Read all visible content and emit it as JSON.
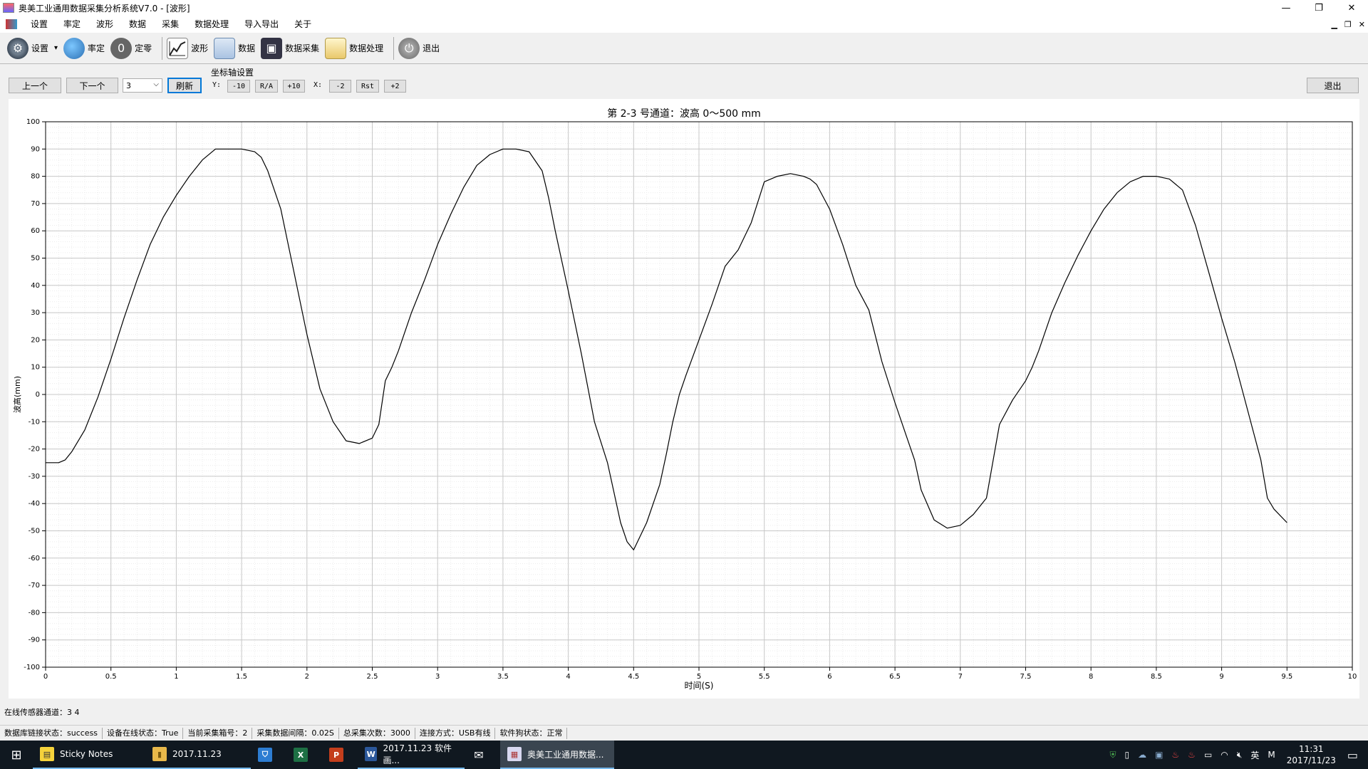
{
  "window": {
    "title": "奥美工业通用数据采集分析系统V7.0 - [波形]",
    "controls": [
      "—",
      "❐",
      "✕"
    ]
  },
  "menu": {
    "items": [
      "设置",
      "率定",
      "波形",
      "数据",
      "采集",
      "数据处理",
      "导入导出",
      "关于"
    ],
    "mdi_controls": [
      "▁",
      "❐",
      "✕"
    ]
  },
  "toolbar": {
    "items": [
      {
        "label": "设置",
        "icon": "gear-icon",
        "dropdown": "▾"
      },
      {
        "label": "率定",
        "icon": "calibrate-icon"
      },
      {
        "label": "定零",
        "icon": "zero-icon",
        "glyph": "0"
      },
      {
        "label": "波形",
        "icon": "waveform-icon"
      },
      {
        "label": "数据",
        "icon": "data-grid-icon"
      },
      {
        "label": "数据采集",
        "icon": "acquisition-icon"
      },
      {
        "label": "数据处理",
        "icon": "processing-icon"
      },
      {
        "label": "退出",
        "icon": "power-icon"
      }
    ]
  },
  "controls": {
    "prev": "上一个",
    "next": "下一个",
    "channel_value": "3",
    "refresh": "刷新",
    "axis_group_title": "坐标轴设置",
    "y_label": "Y:",
    "y_buttons": [
      "-10",
      "R/A",
      "+10"
    ],
    "x_label": "X:",
    "x_buttons": [
      "-2",
      "Rst",
      "+2"
    ],
    "exit": "退出"
  },
  "chart_data": {
    "type": "line",
    "title": "第 2-3 号通道：波高 0～500 mm",
    "xlabel": "时间(S)",
    "ylabel": "波高(mm)",
    "xlim": [
      0,
      10
    ],
    "ylim": [
      -100,
      100
    ],
    "x_ticks": [
      "0",
      "0.5",
      "1",
      "1.5",
      "2",
      "2.5",
      "3",
      "3.5",
      "4",
      "4.5",
      "5",
      "5.5",
      "6",
      "6.5",
      "7",
      "7.5",
      "8",
      "8.5",
      "9",
      "9.5",
      "10"
    ],
    "y_ticks": [
      "100",
      "90",
      "80",
      "70",
      "60",
      "50",
      "40",
      "30",
      "20",
      "10",
      "0",
      "-10",
      "-20",
      "-30",
      "-40",
      "-50",
      "-60",
      "-70",
      "-80",
      "-90",
      "-100"
    ],
    "grid": true,
    "series": [
      {
        "color": "#000000",
        "x": [
          0,
          0.1,
          0.15,
          0.2,
          0.3,
          0.4,
          0.5,
          0.6,
          0.7,
          0.8,
          0.9,
          1.0,
          1.1,
          1.2,
          1.3,
          1.4,
          1.5,
          1.6,
          1.65,
          1.7,
          1.8,
          1.9,
          2.0,
          2.1,
          2.2,
          2.3,
          2.4,
          2.5,
          2.55,
          2.6,
          2.65,
          2.7,
          2.8,
          2.9,
          3.0,
          3.1,
          3.2,
          3.3,
          3.4,
          3.5,
          3.6,
          3.7,
          3.8,
          3.85,
          3.9,
          4.0,
          4.1,
          4.2,
          4.3,
          4.4,
          4.45,
          4.5,
          4.6,
          4.7,
          4.75,
          4.8,
          4.85,
          4.9,
          5.0,
          5.1,
          5.2,
          5.3,
          5.4,
          5.5,
          5.6,
          5.7,
          5.8,
          5.85,
          5.9,
          6.0,
          6.1,
          6.2,
          6.3,
          6.4,
          6.5,
          6.6,
          6.65,
          6.7,
          6.8,
          6.9,
          7.0,
          7.1,
          7.2,
          7.3,
          7.4,
          7.5,
          7.55,
          7.6,
          7.7,
          7.8,
          7.9,
          8.0,
          8.1,
          8.2,
          8.3,
          8.4,
          8.5,
          8.6,
          8.7,
          8.8,
          8.9,
          9.0,
          9.1,
          9.2,
          9.3,
          9.35,
          9.4,
          9.5
        ],
        "y": [
          -25,
          -25,
          -24,
          -21,
          -13,
          -1,
          13,
          28,
          42,
          55,
          65,
          73,
          80,
          86,
          90,
          90,
          90,
          89,
          87,
          82,
          68,
          45,
          22,
          2,
          -10,
          -17,
          -18,
          -16,
          -11,
          5,
          10,
          16,
          30,
          42,
          55,
          66,
          76,
          84,
          88,
          90,
          90,
          89,
          82,
          72,
          60,
          38,
          15,
          -10,
          -25,
          -47,
          -54,
          -57,
          -47,
          -33,
          -22,
          -10,
          0,
          7,
          20,
          33,
          47,
          53,
          63,
          78,
          80,
          81,
          80,
          79,
          77,
          68,
          55,
          40,
          31,
          12,
          -3,
          -17,
          -24,
          -35,
          -46,
          -49,
          -48,
          -44,
          -38,
          -11,
          -2,
          5,
          10,
          16,
          30,
          41,
          51,
          60,
          68,
          74,
          78,
          80,
          80,
          79,
          75,
          62,
          45,
          28,
          12,
          -6,
          -24,
          -38,
          -42,
          -47
        ]
      }
    ]
  },
  "sensor_status": "在线传感器通道：3 4",
  "statusbar": [
    "数据库链接状态：success",
    "设备在线状态：True",
    "当前采集箱号：2",
    "采集数据间隔：0.02S",
    "总采集次数：3000",
    "连接方式：USB有线",
    "软件狗状态：正常"
  ],
  "taskbar": {
    "start": "⊞",
    "tasks": [
      {
        "label": "Sticky Notes",
        "icon": "sticky-notes-icon",
        "color": "#f5d33b",
        "glyph": "▤"
      },
      {
        "label": "2017.11.23",
        "icon": "folder-icon",
        "color": "#e8b84a",
        "glyph": "▮"
      },
      {
        "label": "",
        "icon": "store-icon",
        "color": "#2d7dd2",
        "glyph": "⛉"
      },
      {
        "label": "",
        "icon": "excel-icon",
        "color": "#1d7044",
        "glyph": "X"
      },
      {
        "label": "",
        "icon": "powerpoint-icon",
        "color": "#c43e1c",
        "glyph": "P"
      },
      {
        "label": "2017.11.23 软件画...",
        "icon": "word-icon",
        "color": "#2b579a",
        "glyph": "W"
      },
      {
        "label": "",
        "icon": "mail-icon",
        "color": "#ffffff",
        "glyph": "✉"
      },
      {
        "label": "奥美工业通用数据...",
        "icon": "app-icon",
        "color": "#d8d8f0",
        "glyph": "▦"
      }
    ],
    "tray_lang": "英",
    "tray_m": "M",
    "time": "11:31",
    "date": "2017/11/23"
  }
}
